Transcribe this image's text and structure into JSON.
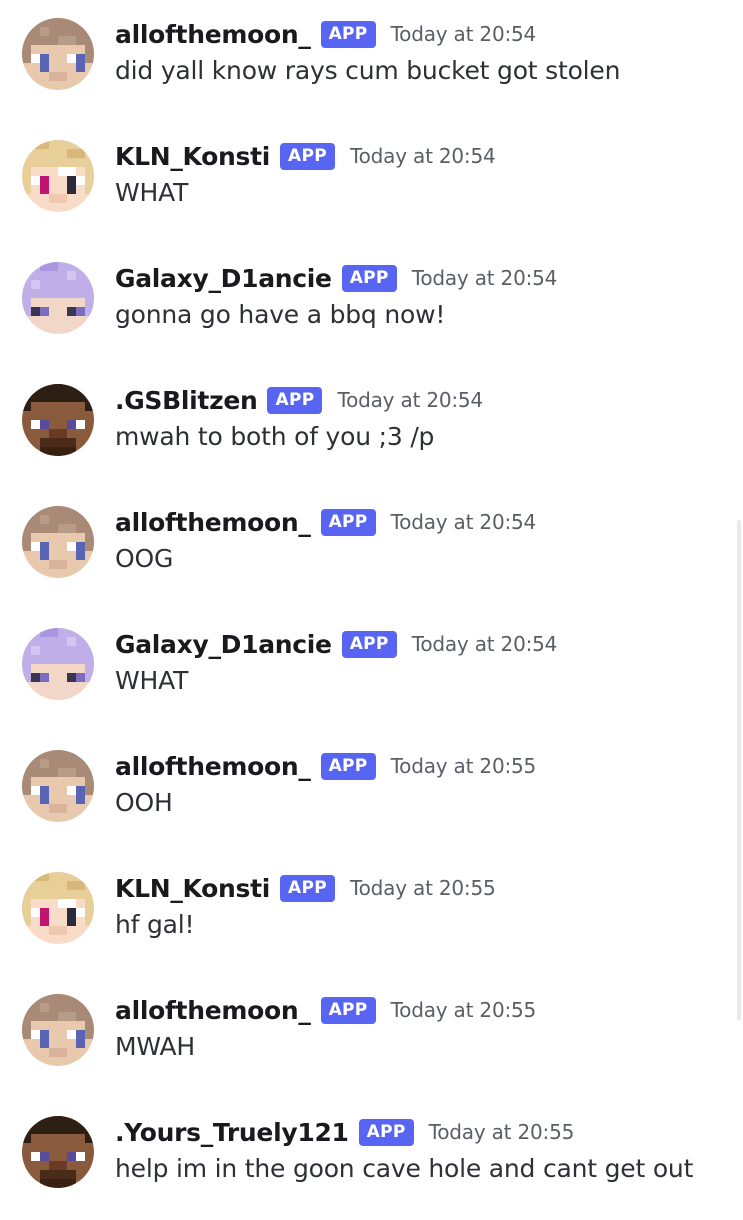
{
  "badge_label": "APP",
  "colors": {
    "badge": "#5865f2",
    "username": "#1a1a1e",
    "timestamp": "#5c5e66",
    "content": "#2e3035"
  },
  "messages": [
    {
      "author": "allofthemoon_",
      "badge": "APP",
      "timestamp": "Today at 20:54",
      "content": "did yall know rays cum bucket got stolen",
      "avatar": "skin-brown-hair-icon"
    },
    {
      "author": "KLN_Konsti",
      "badge": "APP",
      "timestamp": "Today at 20:54",
      "content": "WHAT",
      "avatar": "skin-blonde-hair-icon"
    },
    {
      "author": "Galaxy_D1ancie",
      "badge": "APP",
      "timestamp": "Today at 20:54",
      "content": "gonna go have a bbq now!",
      "avatar": "skin-lavender-hair-icon"
    },
    {
      "author": ".GSBlitzen",
      "badge": "APP",
      "timestamp": "Today at 20:54",
      "content": "mwah to both of you ;3 /p",
      "avatar": "skin-steve-icon"
    },
    {
      "author": "allofthemoon_",
      "badge": "APP",
      "timestamp": "Today at 20:54",
      "content": "OOG",
      "avatar": "skin-brown-hair-icon"
    },
    {
      "author": "Galaxy_D1ancie",
      "badge": "APP",
      "timestamp": "Today at 20:54",
      "content": "WHAT",
      "avatar": "skin-lavender-hair-icon"
    },
    {
      "author": "allofthemoon_",
      "badge": "APP",
      "timestamp": "Today at 20:55",
      "content": "OOH",
      "avatar": "skin-brown-hair-icon"
    },
    {
      "author": "KLN_Konsti",
      "badge": "APP",
      "timestamp": "Today at 20:55",
      "content": "hf gal!",
      "avatar": "skin-blonde-hair-icon"
    },
    {
      "author": "allofthemoon_",
      "badge": "APP",
      "timestamp": "Today at 20:55",
      "content": "MWAH",
      "avatar": "skin-brown-hair-icon"
    },
    {
      "author": ".Yours_Truely121",
      "badge": "APP",
      "timestamp": "Today at 20:55",
      "content": "help im in the goon cave hole and cant get out",
      "avatar": "skin-steve-icon"
    }
  ]
}
